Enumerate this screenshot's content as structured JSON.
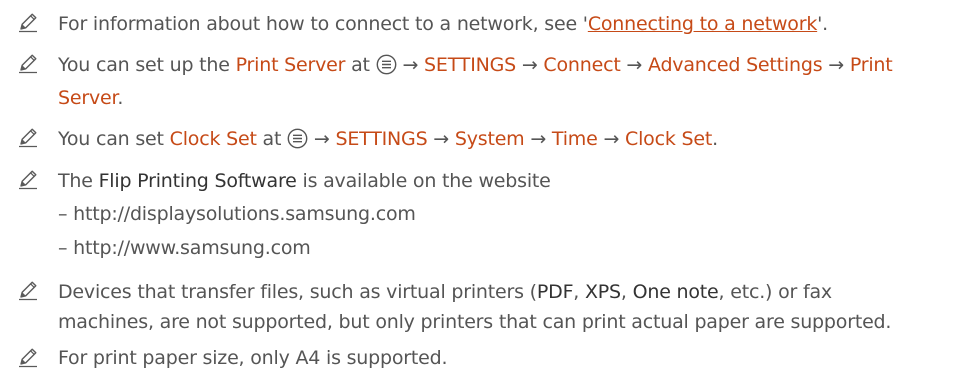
{
  "n1": {
    "pre": "For information about how to connect to a network, see '",
    "link": "Connecting to a network",
    "post": "'."
  },
  "n2": {
    "pre": "You can set up the ",
    "item": "Print Server",
    "at": " at ",
    "arrow": " → ",
    "path1": "SETTINGS",
    "path2": "Connect",
    "path3": "Advanced Settings",
    "path4a": "Print",
    "path4b": "Server",
    "end": "."
  },
  "n3": {
    "pre": "You can set ",
    "item": "Clock Set",
    "at": " at ",
    "arrow": " → ",
    "path1": "SETTINGS",
    "path2": "System",
    "path3": "Time",
    "path4": "Clock Set",
    "end": "."
  },
  "n4": {
    "pre": "The ",
    "item": "Flip Printing Software",
    "post": " is available on the website",
    "sub1": "– http://displaysolutions.samsung.com",
    "sub2": "– http://www.samsung.com"
  },
  "n5": {
    "pre": "Devices that transfer files, such as virtual printers (",
    "t1": "PDF",
    "c1": ", ",
    "t2": "XPS",
    "c2": ", ",
    "t3": "One note",
    "post": ", etc.) or fax",
    "line2": "machines, are not supported, but only printers that can print actual paper are supported."
  },
  "n6": {
    "text": "For print paper size, only A4 is supported."
  },
  "icons": {
    "note": "pencil-icon",
    "menu": "menu-icon"
  },
  "colors": {
    "highlight": "#c64a17",
    "text": "#555555"
  }
}
